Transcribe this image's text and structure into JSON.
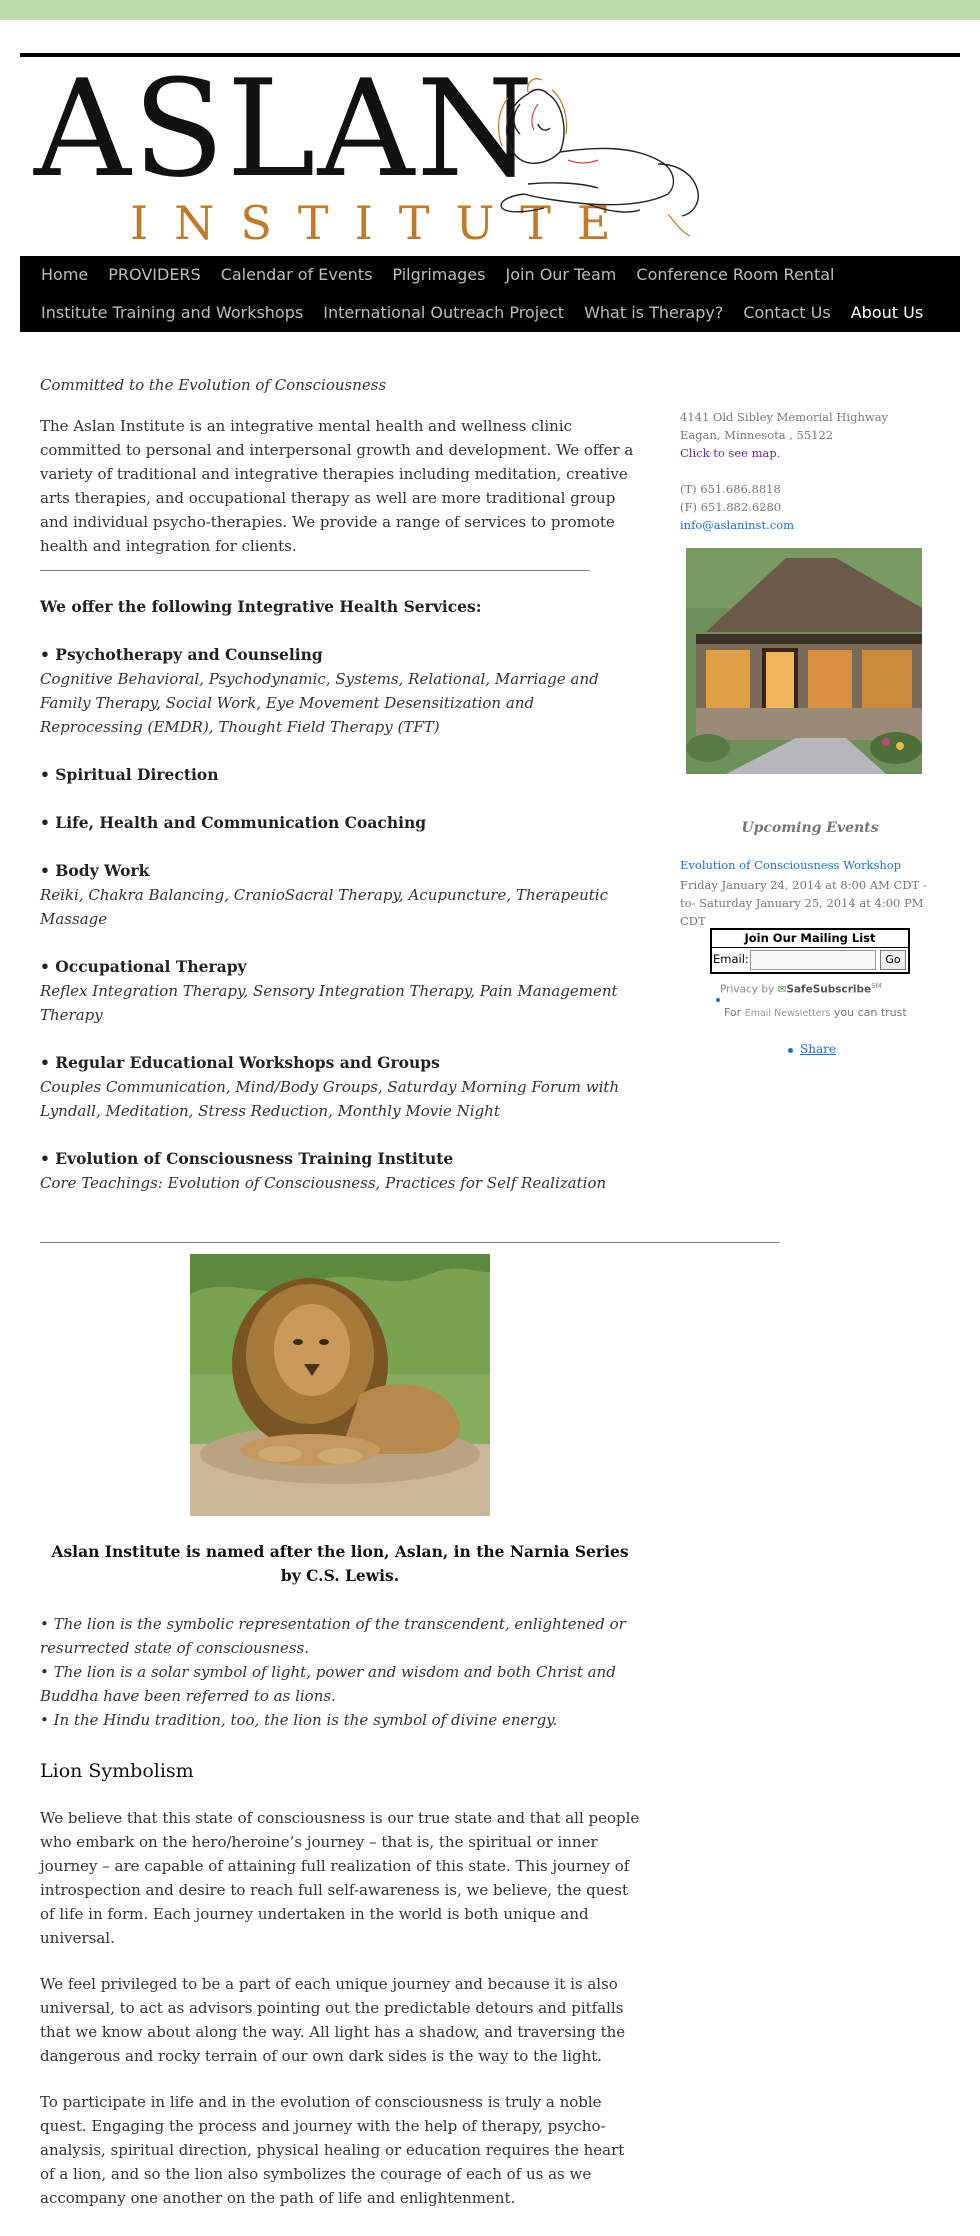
{
  "logo": {
    "word": "ASLAN",
    "sub": "INSTITUTE"
  },
  "nav": {
    "row1": [
      "Home",
      "PROVIDERS",
      "Calendar of Events",
      "Pilgrimages",
      "Join Our Team",
      "Conference Room Rental"
    ],
    "row2": [
      "Institute Training and Workshops",
      "International Outreach Project",
      "What is Therapy?",
      "Contact Us",
      "About Us"
    ],
    "active": "About Us"
  },
  "main": {
    "tagline": "Committed to the Evolution of Consciousness",
    "intro": "The Aslan Institute is an integrative mental health and wellness clinic committed to personal and interpersonal growth and development. We offer a variety of traditional and integrative therapies including meditation, creative arts therapies, and occupational therapy as well are more traditional group and individual psycho-therapies. We provide a range of services to promote health and integration for clients.",
    "offer_heading": "We offer the following Integrative Health Services:",
    "services": [
      {
        "title": "• Psychotherapy and Counseling",
        "desc": "Cognitive Behavioral, Psychodynamic, Systems, Relational, Marriage and Family Therapy, Social Work, Eye Movement Desensitization and Reprocessing (EMDR), Thought Field Therapy (TFT)"
      },
      {
        "title": "• Spiritual Direction",
        "desc": ""
      },
      {
        "title": "• Life, Health and Communication Coaching",
        "desc": ""
      },
      {
        "title": "• Body Work",
        "desc": "Reiki, Chakra Balancing, CranioSacral Therapy, Acupuncture, Therapeutic Massage"
      },
      {
        "title": "•  Occupational Therapy",
        "desc": "Reflex Integration Therapy, Sensory Integration Therapy, Pain Management Therapy"
      },
      {
        "title": "• Regular Educational Workshops and Groups",
        "desc": "Couples Communication, Mind/Body Groups, Saturday Morning Forum with Lyndall, Meditation, Stress Reduction, Monthly Movie Night"
      },
      {
        "title": "• Evolution of Consciousness Training Institute",
        "desc": "Core Teachings: Evolution of Consciousness, Practices for Self Realization"
      }
    ]
  },
  "lower": {
    "named": "Aslan Institute is named after the lion, Aslan, in the Narnia Series by C.S. Lewis.",
    "bullets": [
      "• The lion is the symbolic representation of the transcendent, enlightened or resurrected state of consciousness.",
      "• The lion is a solar symbol of light, power and wisdom and both Christ and Buddha have been referred to as lions.",
      "• In the Hindu tradition, too, the lion is the symbol of divine energy."
    ],
    "heading": "Lion Symbolism",
    "paragraphs": [
      "We believe that this state of consciousness is our true state and that all people who embark on the hero/heroine’s journey – that is, the spiritual or inner journey – are capable of attaining full realization of this state. This journey of introspection and desire to reach full self-awareness is, we believe, the quest of life in form. Each journey undertaken in the world is both unique and universal.",
      "We feel privileged to be a part of each unique journey and because it is also universal, to act as advisors pointing out the predictable detours and pitfalls that we know about along the way. All light has a shadow, and traversing the dangerous and rocky terrain of our own dark sides is the way to the light.",
      "To participate in life and in the evolution of consciousness is truly a noble quest. Engaging the process and journey with the help of therapy, psycho-analysis, spiritual direction, physical healing or education requires the heart of a lion, and so the lion also symbolizes the courage of each of us as we accompany one another on the path of life and enlightenment."
    ]
  },
  "sidebar": {
    "address1": "4141 Old Sibley Memorial Highway",
    "address2": "Eagan, Minnesota , 55122",
    "map_link": "Click to see map.",
    "phone": "(T) 651.686.8818",
    "fax": "(F) 651.882.6280",
    "email": "info@aslaninst.com",
    "events_title": "Upcoming Events",
    "event_link": "Evolution of Consciousness Workshop",
    "event_date": "Friday January 24, 2014 at 8:00 AM CDT -to- Saturday January 25, 2014 at 4:00 PM CDT",
    "mailing": {
      "title": "Join Our Mailing List",
      "email_label": "Email:",
      "email_value": "",
      "go": "Go",
      "privacy_by": "Privacy by",
      "safe": "SafeSubscribe",
      "sm": "SM",
      "trust_pre": "For",
      "trust_mid": "Email Newsletters",
      "trust_post": "you can trust"
    },
    "share": "Share"
  },
  "colors": {
    "topbar": "#b9dcaa",
    "nav_bg": "#000000",
    "logo_sub": "#c07a28",
    "link_blue": "#1a6fcf",
    "link_purple": "#6b2b91"
  }
}
